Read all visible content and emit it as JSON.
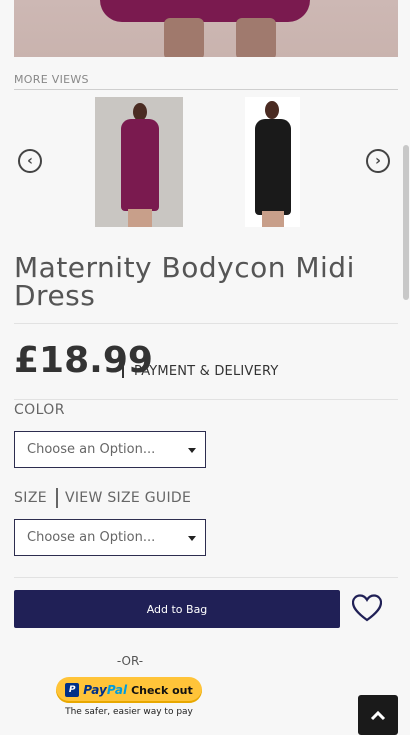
{
  "gallery": {
    "more_views_label": "MORE VIEWS",
    "thumbnail_colors": [
      "#7a1a4f",
      "#1a1a1a"
    ]
  },
  "product": {
    "title": "Maternity Bodycon Midi Dress",
    "price": "£18.99",
    "payment_link": "PAYMENT & DELIVERY"
  },
  "options": {
    "color_label": "COLOR",
    "color_placeholder": "Choose an Option...",
    "size_label": "SIZE",
    "size_guide_link": "VIEW SIZE GUIDE",
    "size_placeholder": "Choose an Option..."
  },
  "actions": {
    "add_to_bag": "Add to Bag",
    "or_text": "-OR-",
    "paypal_word": "PayPal",
    "paypal_pay": "Pay",
    "paypal_pal": "Pal",
    "paypal_checkout": "Check out",
    "paypal_tagline": "The safer, easier way to pay"
  },
  "icons": {
    "prev": "chevron-left-circle-icon",
    "next": "chevron-right-circle-icon",
    "wishlist": "heart-icon",
    "back_to_top": "chevron-up-icon"
  },
  "colors": {
    "brand_navy": "#202056",
    "paypal_yellow": "#ffc439",
    "paypal_blue": "#003087",
    "paypal_light_blue": "#009cde"
  }
}
